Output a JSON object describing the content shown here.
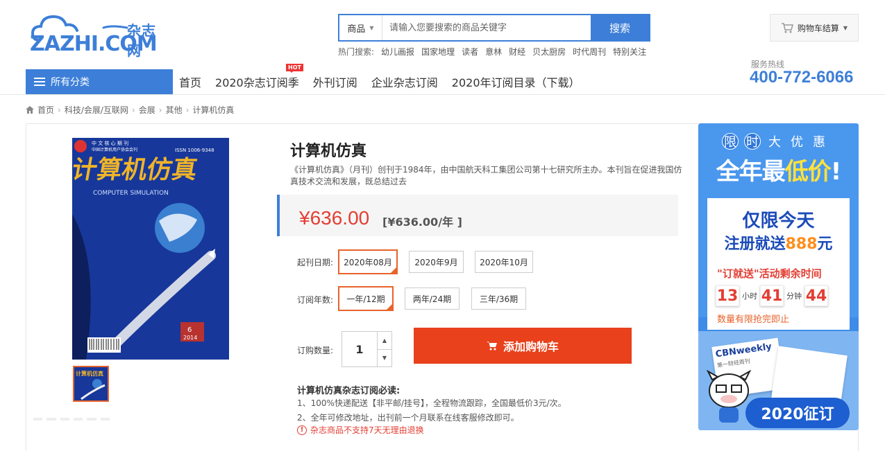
{
  "header": {
    "logo_main": "ZAZHI.COM",
    "logo_sub": "杂志网",
    "search": {
      "category": "商品",
      "placeholder": "请输入您要搜索的商品关键字",
      "button": "搜索"
    },
    "hot_search": {
      "label": "热门搜索:",
      "items": [
        "幼儿画报",
        "国家地理",
        "读者",
        "意林",
        "财经",
        "贝太厨房",
        "时代周刊",
        "特别关注"
      ]
    },
    "cart_label": "购物车结算",
    "hotline_label": "服务热线",
    "hotline": "400-772-6066"
  },
  "nav": {
    "all_categories": "所有分类",
    "items": [
      "首页",
      "2020杂志订阅季",
      "外刊订阅",
      "企业杂志订阅",
      "2020年订阅目录（下载）"
    ],
    "hot_badge": "HOT"
  },
  "breadcrumb": [
    "首页",
    "科技/会展/互联网",
    "会展",
    "其他",
    "计算机仿真"
  ],
  "product": {
    "title": "计算机仿真",
    "description": "《计算机仿真》（月刊）创刊于1984年，由中国航天科工集团公司第十七研究所主办。本刊旨在促进我国仿真技术交流和发展，既总结过去",
    "price": "¥636.00",
    "price_per_year": "[¥636.00/年 ]",
    "cover": {
      "title_cn": "计算机仿真",
      "title_en": "COMPUTER SIMULATION",
      "issn": "ISSN 1006-9348",
      "issue": "6",
      "year": "2014"
    },
    "start_date": {
      "label": "起刊日期:",
      "options": [
        "2020年08月",
        "2020年9月",
        "2020年10月"
      ],
      "selected": "2020年08月"
    },
    "years": {
      "label": "订阅年数:",
      "options": [
        "一年/12期",
        "两年/24期",
        "三年/36期"
      ],
      "selected": "一年/12期"
    },
    "quantity": {
      "label": "订购数量:",
      "value": "1"
    },
    "add_to_cart": "添加购物车",
    "notice": {
      "title": "计算机仿真杂志订阅必读:",
      "lines": [
        "1、100%快递配送【非平邮/挂号】，全程物流跟踪，全国最低价3元/次。",
        "2、全年可修改地址，出刊前一个月联系在线客服修改即可。"
      ],
      "warning": "杂志商品不支持7天无理由退换"
    }
  },
  "promo": {
    "top_chars": [
      "限",
      "时",
      "大",
      "优",
      "惠"
    ],
    "big_title_a": "全年最",
    "big_title_b": "低价",
    "big_title_c": "!",
    "card_title": "仅限今天",
    "card_sub_a": "注册就送",
    "card_sub_b": "888",
    "card_sub_c": "元",
    "countdown_label": "\"订就送\"活动剩余时间",
    "countdown": {
      "hours": "13",
      "hours_unit": "小时",
      "minutes": "41",
      "minutes_unit": "分钟",
      "seconds": "44"
    },
    "limited_note": "数量有限抢完即止",
    "magazine_name": "CBNweekly",
    "magazine_sub": "第一财经周刊",
    "bottom_badge": "2020征订"
  },
  "colors": {
    "brand_blue": "#3d7fd8",
    "price_red": "#e33e33",
    "select_orange": "#e8622a",
    "cart_button": "#e8411b"
  }
}
